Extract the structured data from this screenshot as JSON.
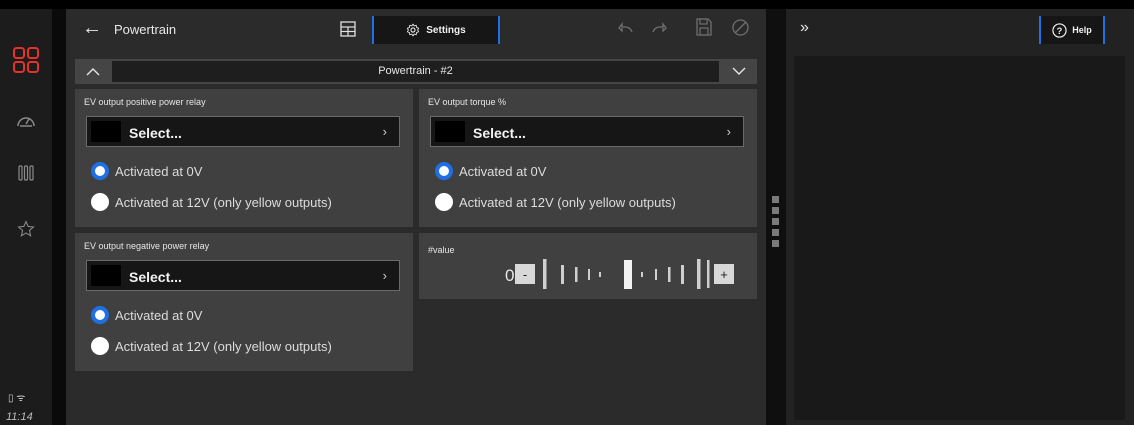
{
  "sidebar": {
    "time": "11:14",
    "status_icons": "▯ ᯤ",
    "items": [
      {
        "icon": "app-grid-icon"
      },
      {
        "icon": "speedometer-icon"
      },
      {
        "icon": "columns-icon"
      },
      {
        "icon": "star-icon"
      }
    ],
    "accent": "#e5322b"
  },
  "toolbar": {
    "back_glyph": "←",
    "title": "Powertrain",
    "settings_label": "Settings",
    "accent": "#1f6fe5"
  },
  "selector": {
    "value": "Powertrain - #2"
  },
  "cards": {
    "pos_relay": {
      "label": "EV output positive power relay",
      "select_label": "Select...",
      "option_0v": "Activated at 0V",
      "option_12v": "Activated at 12V (only yellow outputs)",
      "selected": "option_0v"
    },
    "torque": {
      "label": "EV output torque %",
      "select_label": "Select...",
      "option_0v": "Activated at 0V",
      "option_12v": "Activated at 12V (only yellow outputs)",
      "selected": "option_0v"
    },
    "neg_relay": {
      "label": "EV output negative power relay",
      "select_label": "Select...",
      "option_0v": "Activated at 0V",
      "option_12v": "Activated at 12V (only yellow outputs)",
      "selected": "option_0v"
    },
    "value": {
      "label": "#value",
      "current": "0",
      "minus_label": "-",
      "plus_label": "+"
    }
  },
  "right_panel": {
    "expand_glyph": "»",
    "help_label": "Help"
  }
}
